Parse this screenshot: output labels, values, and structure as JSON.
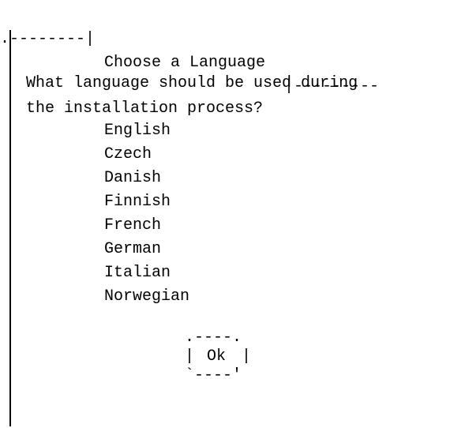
{
  "dialog": {
    "title": "Choose a Language",
    "prompt_line1": "What language should be used during",
    "prompt_line2": "the installation process?",
    "languages": [
      "English",
      "Czech",
      "Danish",
      "Finnish",
      "French",
      "German",
      "Italian",
      "Norwegian"
    ],
    "ok_label": "Ok"
  },
  "colors": {
    "background": "#ffffff",
    "text": "#000000"
  }
}
